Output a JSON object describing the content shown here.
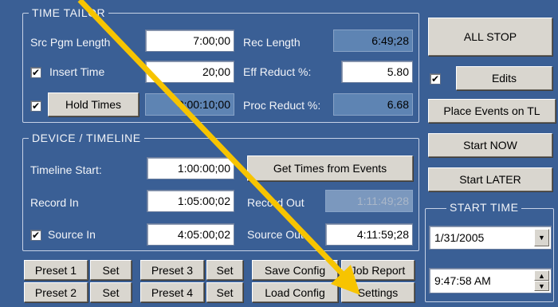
{
  "time_tailor": {
    "title": "TIME TAILOR",
    "src_pgm_length_label": "Src Pgm Length",
    "src_pgm_length_value": "7:00;00",
    "rec_length_label": "Rec Length",
    "rec_length_value": "6:49;28",
    "insert_time_label": "Insert Time",
    "insert_time_checked": true,
    "insert_time_value": "20;00",
    "eff_reduct_label": "Eff Reduct %:",
    "eff_reduct_value": "5.80",
    "hold_times_checked": true,
    "hold_times_label": "Hold Times",
    "hold_times_value": "0:00:10;00",
    "proc_reduct_label": "Proc Reduct %:",
    "proc_reduct_value": "6.68"
  },
  "device_timeline": {
    "title": "DEVICE / TIMELINE",
    "timeline_start_label": "Timeline Start:",
    "timeline_start_value": "1:00:00;00",
    "get_times_label": "Get Times from Events",
    "record_in_label": "Record In",
    "record_in_value": "1:05:00;02",
    "record_out_label": "Record Out",
    "record_out_value": "1:11:49;28",
    "source_in_checked": true,
    "source_in_label": "Source In",
    "source_in_value": "4:05:00;02",
    "source_out_label": "Source Out",
    "source_out_value": "4:11:59;28"
  },
  "bottom_buttons": {
    "preset1": "Preset 1",
    "set1": "Set",
    "preset3": "Preset 3",
    "set3": "Set",
    "save_config": "Save Config",
    "job_report": "Job Report",
    "preset2": "Preset 2",
    "set2": "Set",
    "preset4": "Preset 4",
    "set4": "Set",
    "load_config": "Load Config",
    "settings": "Settings"
  },
  "right_panel": {
    "all_stop": "ALL STOP",
    "edits_checked": true,
    "edits": "Edits",
    "place_events": "Place Events on TL",
    "start_now": "Start NOW",
    "start_later": "Start LATER",
    "start_time_title": "START TIME",
    "date_value": "1/31/2005",
    "time_value": "9:47:58 AM"
  },
  "colors": {
    "background": "#3a5f95",
    "button_face": "#d9d6cf",
    "annotation_arrow": "#f7c400"
  },
  "icons": [
    "checkmark-icon",
    "chevron-down-icon",
    "spin-up-icon",
    "spin-down-icon",
    "annotation-arrow"
  ]
}
